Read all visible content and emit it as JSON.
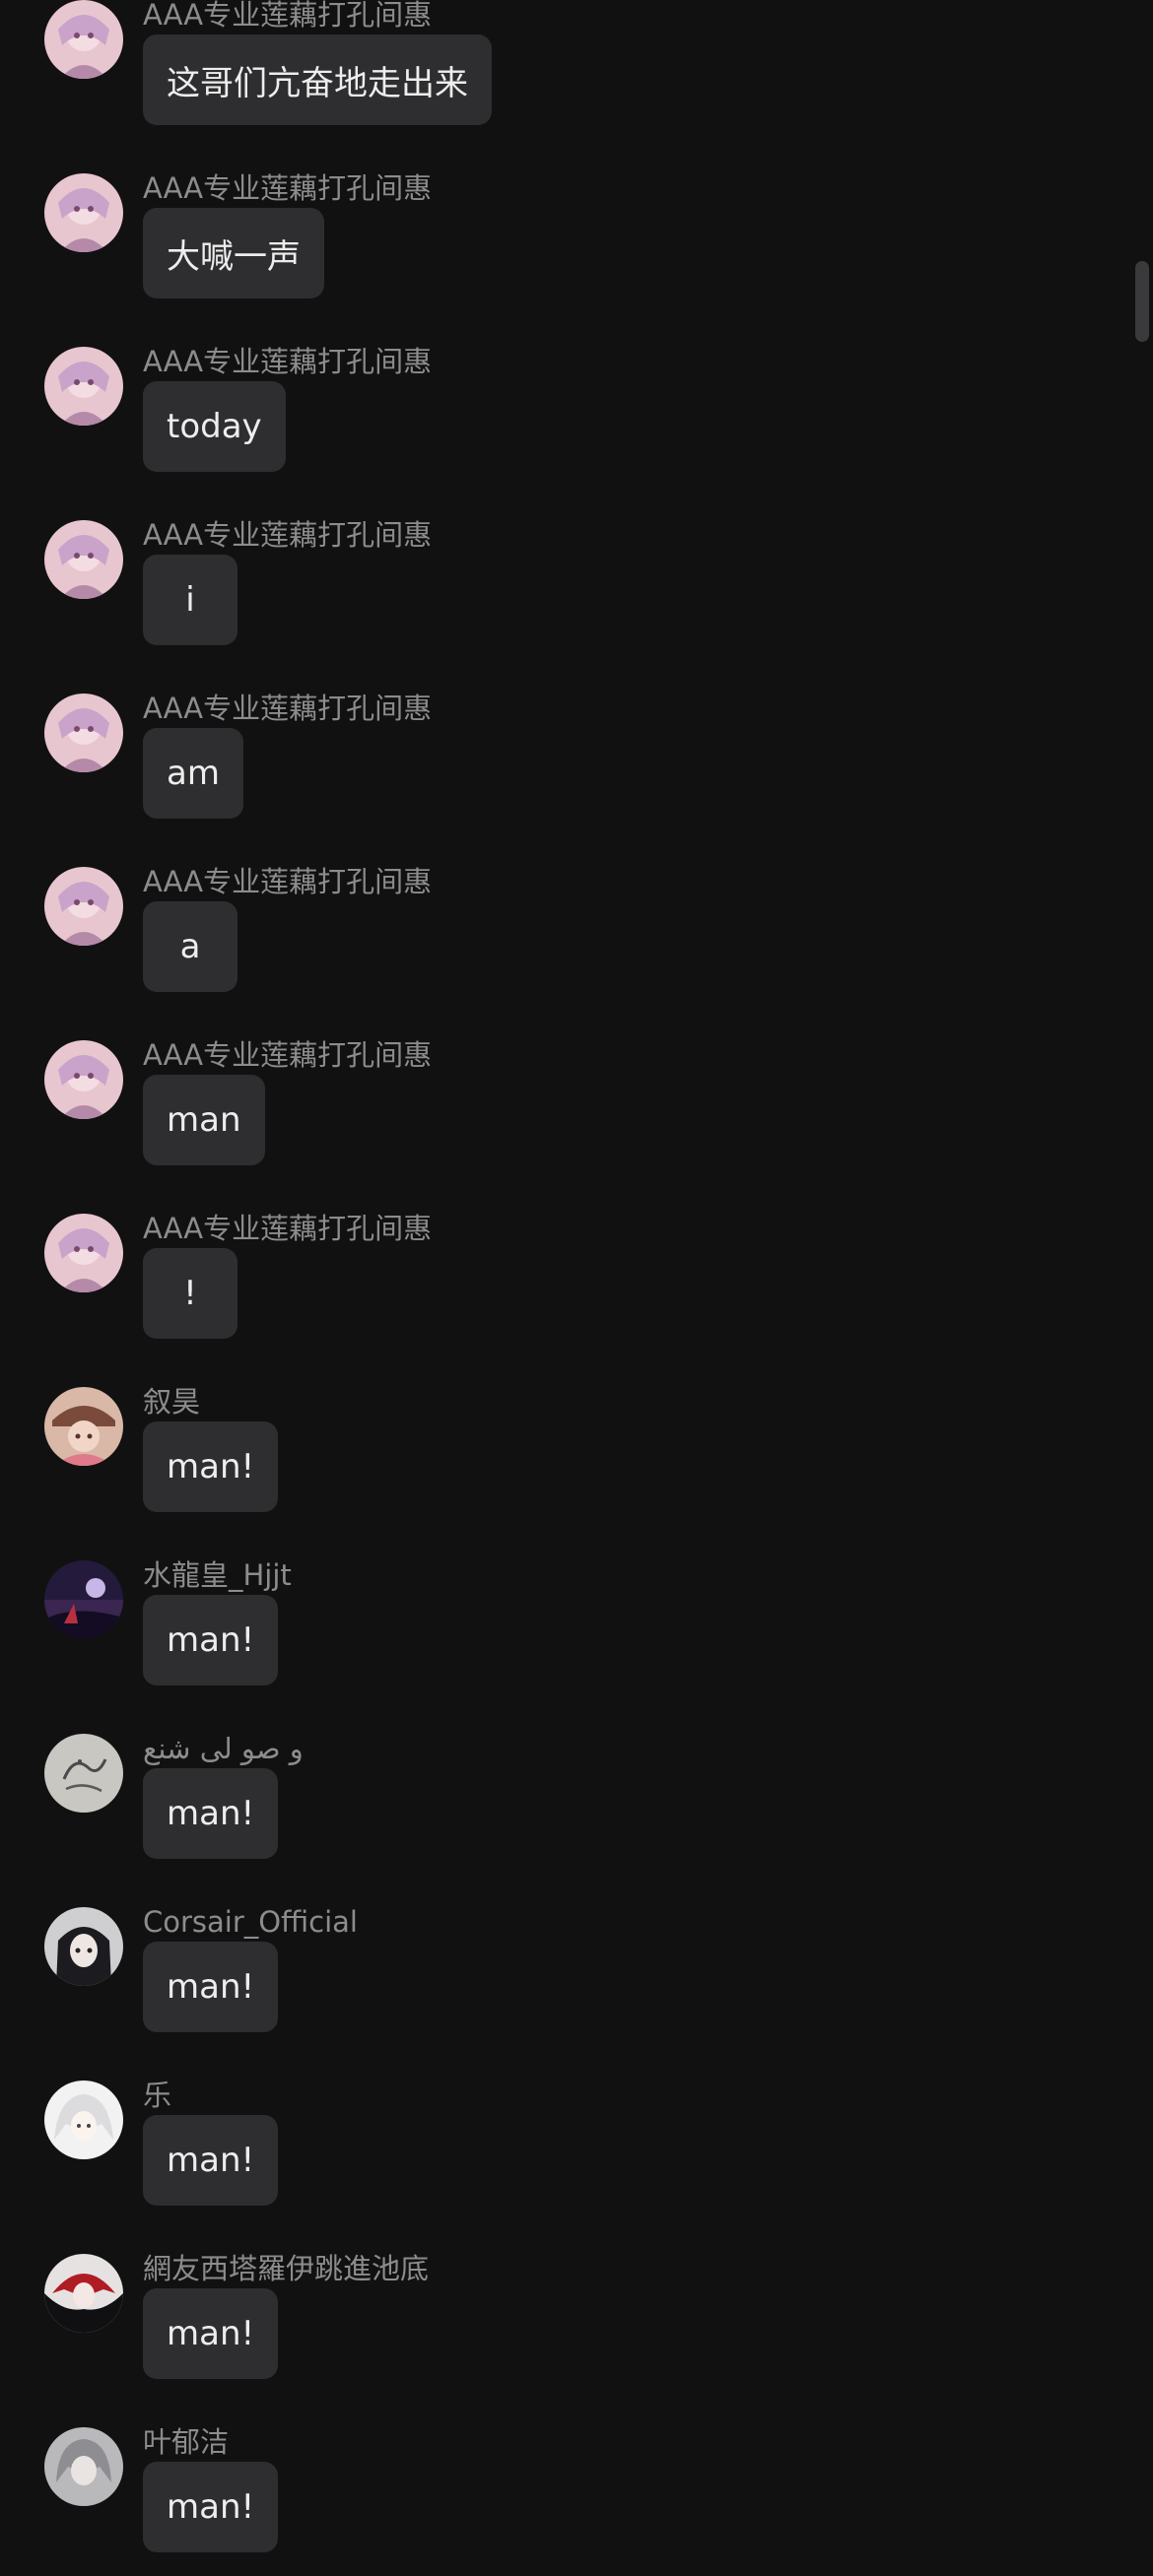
{
  "messages": [
    {
      "sender": "AAA专业莲藕打孔间惠",
      "text": "这哥们亢奋地走出来",
      "avatar": "pink-anime-avatar"
    },
    {
      "sender": "AAA专业莲藕打孔间惠",
      "text": "大喊一声",
      "avatar": "pink-anime-avatar"
    },
    {
      "sender": "AAA专业莲藕打孔间惠",
      "text": "today",
      "avatar": "pink-anime-avatar"
    },
    {
      "sender": "AAA专业莲藕打孔间惠",
      "text": "i",
      "avatar": "pink-anime-avatar"
    },
    {
      "sender": "AAA专业莲藕打孔间惠",
      "text": "am",
      "avatar": "pink-anime-avatar"
    },
    {
      "sender": "AAA专业莲藕打孔间惠",
      "text": "a",
      "avatar": "pink-anime-avatar"
    },
    {
      "sender": "AAA专业莲藕打孔间惠",
      "text": "man",
      "avatar": "pink-anime-avatar"
    },
    {
      "sender": "AAA专业莲藕打孔间惠",
      "text": "!",
      "avatar": "pink-anime-avatar"
    },
    {
      "sender": "叙昊",
      "text": "man!",
      "avatar": "hat-girl-avatar"
    },
    {
      "sender": "水龍皇_Hjjt",
      "text": "man!",
      "avatar": "night-sky-avatar"
    },
    {
      "sender": "و صو لی شنع",
      "text": "man!",
      "avatar": "calligraphy-avatar"
    },
    {
      "sender": "Corsair_Official",
      "text": "man!",
      "avatar": "dark-hair-avatar"
    },
    {
      "sender": "乐",
      "text": "man!",
      "avatar": "white-hair-avatar"
    },
    {
      "sender": "網友西塔羅伊跳進池底",
      "text": "man!",
      "avatar": "red-black-avatar"
    },
    {
      "sender": "叶郁洁",
      "text": "man!",
      "avatar": "gray-anime-avatar"
    }
  ],
  "colors": {
    "background": "#111112",
    "bubble": "#2e2e30",
    "message_text": "#ededed",
    "sender_name": "#8c8c8c"
  }
}
